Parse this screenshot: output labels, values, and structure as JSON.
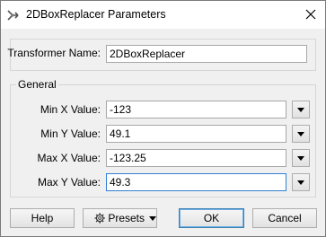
{
  "window": {
    "title": "2DBoxReplacer Parameters",
    "close_icon": "close-icon"
  },
  "transformer": {
    "label": "Transformer Name:",
    "value": "2DBoxReplacer"
  },
  "general": {
    "legend": "General",
    "fields": [
      {
        "label": "Min X Value:",
        "value": "-123"
      },
      {
        "label": "Min Y Value:",
        "value": "49.1"
      },
      {
        "label": "Max X Value:",
        "value": "-123.25"
      },
      {
        "label": "Max Y Value:",
        "value": "49.3"
      }
    ]
  },
  "buttons": {
    "help": "Help",
    "presets": "Presets",
    "ok": "OK",
    "cancel": "Cancel"
  }
}
